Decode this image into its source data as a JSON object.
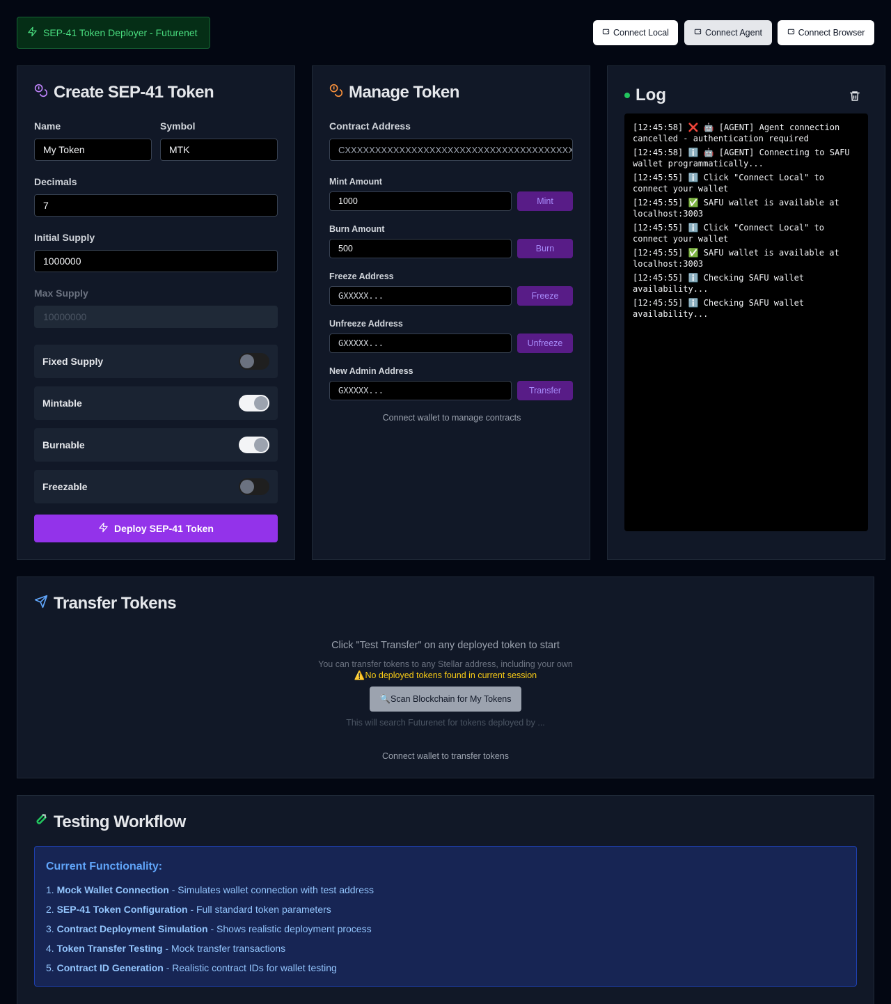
{
  "header": {
    "badge": "SEP-41 Token Deployer - Futurenet",
    "buttons": [
      "Connect Local",
      "Connect Agent",
      "Connect Browser"
    ]
  },
  "create": {
    "title": "Create SEP-41 Token",
    "name_label": "Name",
    "name_value": "My Token",
    "symbol_label": "Symbol",
    "symbol_value": "MTK",
    "decimals_label": "Decimals",
    "decimals_value": "7",
    "initial_supply_label": "Initial Supply",
    "initial_supply_value": "1000000",
    "max_supply_label": "Max Supply",
    "max_supply_placeholder": "10000000",
    "toggles": [
      {
        "label": "Fixed Supply",
        "on": false
      },
      {
        "label": "Mintable",
        "on": true
      },
      {
        "label": "Burnable",
        "on": true
      },
      {
        "label": "Freezable",
        "on": false
      }
    ],
    "deploy_label": "Deploy SEP-41 Token"
  },
  "manage": {
    "title": "Manage Token",
    "contract_label": "Contract Address",
    "contract_placeholder": "CXXXXXXXXXXXXXXXXXXXXXXXXXXXXXXXXXXXXXXXXXXXXXXXXXXXXXXXX",
    "mint_label": "Mint Amount",
    "mint_value": "1000",
    "mint_button": "Mint",
    "burn_label": "Burn Amount",
    "burn_value": "500",
    "burn_button": "Burn",
    "freeze_label": "Freeze Address",
    "freeze_placeholder": "GXXXXX...",
    "freeze_button": "Freeze",
    "unfreeze_label": "Unfreeze Address",
    "unfreeze_placeholder": "GXXXXX...",
    "unfreeze_button": "Unfreeze",
    "admin_label": "New Admin Address",
    "admin_placeholder": "GXXXXX...",
    "admin_button": "Transfer",
    "hint": "Connect wallet to manage contracts"
  },
  "log": {
    "title": "Log",
    "entries": [
      "[12:45:58] ❌ 🤖 [AGENT] Agent connection cancelled - authentication required",
      "[12:45:58] ℹ️ 🤖 [AGENT] Connecting to SAFU wallet programmatically...",
      "[12:45:55] ℹ️ Click \"Connect Local\" to connect your wallet",
      "[12:45:55] ✅ SAFU wallet is available at localhost:3003",
      "[12:45:55] ℹ️ Click \"Connect Local\" to connect your wallet",
      "[12:45:55] ✅ SAFU wallet is available at localhost:3003",
      "[12:45:55] ℹ️ Checking SAFU wallet availability...",
      "[12:45:55] ℹ️ Checking SAFU wallet availability..."
    ]
  },
  "transfer": {
    "title": "Transfer Tokens",
    "instruction": "Click \"Test Transfer\" on any deployed token to start",
    "subtext": "You can transfer tokens to any Stellar address, including your own",
    "warning": "⚠️No deployed tokens found in current session",
    "scan_button": "🔍Scan Blockchain for My Tokens",
    "scan_hint": "This will search Futurenet for tokens deployed by ...",
    "connect_hint": "Connect wallet to transfer tokens"
  },
  "workflow": {
    "title": "Testing Workflow",
    "box_title": "Current Functionality:",
    "items": [
      {
        "num": "1.",
        "bold": "Mock Wallet Connection",
        "text": " - Simulates wallet connection with test address"
      },
      {
        "num": "2.",
        "bold": "SEP-41 Token Configuration",
        "text": " - Full standard token parameters"
      },
      {
        "num": "3.",
        "bold": "Contract Deployment Simulation",
        "text": " - Shows realistic deployment process"
      },
      {
        "num": "4.",
        "bold": "Token Transfer Testing",
        "text": " - Mock transfer transactions"
      },
      {
        "num": "5.",
        "bold": "Contract ID Generation",
        "text": " - Realistic contract IDs for wallet testing"
      }
    ]
  },
  "colors": {
    "accent_purple": "#9333ea",
    "success_green": "#4ade80",
    "info_blue": "#60a5fa",
    "warning_yellow": "#facc15"
  }
}
